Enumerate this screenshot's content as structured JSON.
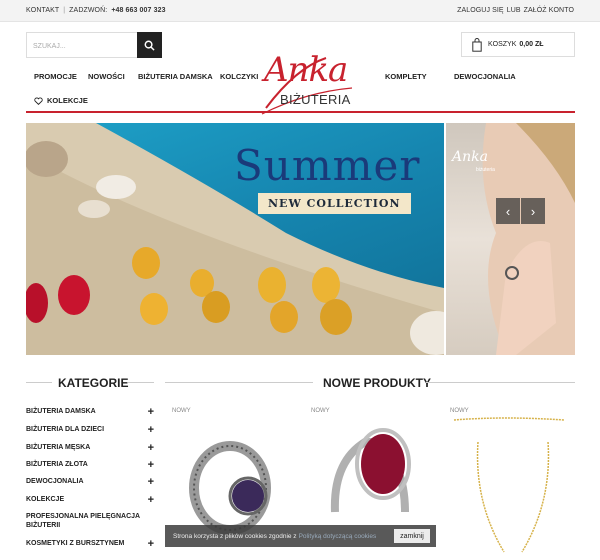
{
  "topbar": {
    "contact": "KONTAKT",
    "call_label": "ZADZWOŃ:",
    "phone": "+48 663 007 323",
    "login": "ZALOGUJ SIĘ",
    "or": "LUB",
    "register": "ZAŁÓŻ KONTO"
  },
  "search": {
    "placeholder": "SZUKAJ..."
  },
  "logo": {
    "script": "Anka",
    "sub": "BIŻUTERIA"
  },
  "cart": {
    "label": "KOSZYK",
    "amount": "0,00 ZŁ"
  },
  "nav": {
    "items": [
      "PROMOCJE",
      "NOWOŚCI",
      "BIŻUTERIA DAMSKA",
      "KOLCZYKI",
      "KOMPLETY",
      "DEWOCJONALIA",
      "KOLEKCJE"
    ]
  },
  "banner": {
    "title": "Summer",
    "subtitle": "NEW COLLECTION",
    "side_logo": "Anka",
    "side_logo_sub": "biżuteria",
    "prev": "‹",
    "next": "›"
  },
  "categories": {
    "heading": "KATEGORIE",
    "items": [
      "BIŻUTERIA DAMSKA",
      "BIŻUTERIA DLA DZIECI",
      "BIŻUTERIA MĘSKA",
      "BIŻUTERIA ZŁOTA",
      "DEWOCJONALIA",
      "KOLEKCJE",
      "PROFESJONALNA PIELĘGNACJA BIŻUTERII",
      "KOSMETYKI Z BURSZTYNEM"
    ]
  },
  "products": {
    "heading": "NOWE PRODUKTY",
    "badge": "NOWY"
  },
  "cookie": {
    "text": "Strona korzysta z plików cookies zgodnie z",
    "link": "Polityką dotyczącą cookies",
    "close": "zamknij"
  },
  "colors": {
    "accent": "#c8222e",
    "dark": "#222222"
  }
}
